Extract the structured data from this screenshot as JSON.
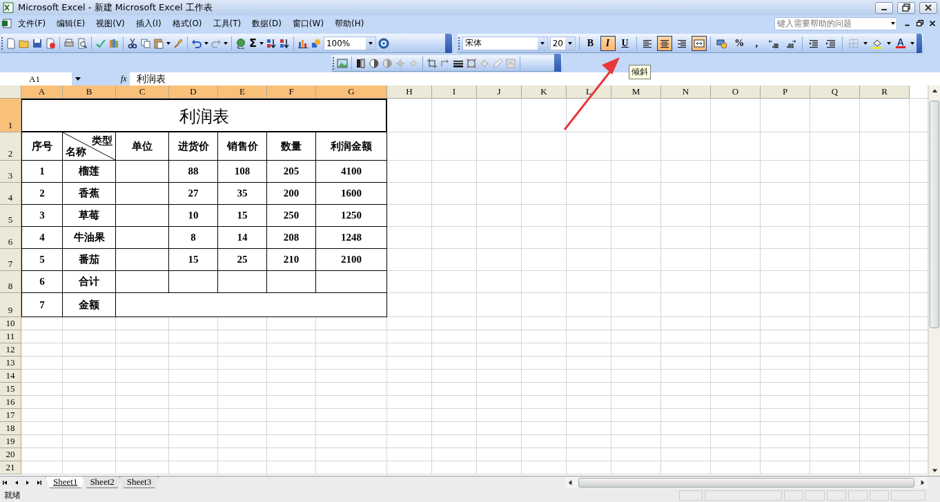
{
  "window": {
    "title": "Microsoft Excel - 新建 Microsoft Excel 工作表"
  },
  "menu": {
    "items": [
      "文件(F)",
      "编辑(E)",
      "视图(V)",
      "插入(I)",
      "格式(O)",
      "工具(T)",
      "数据(D)",
      "窗口(W)",
      "帮助(H)"
    ],
    "help_search": {
      "placeholder": "键入需要帮助的问题"
    }
  },
  "standard_toolbar": {
    "sum_symbol": "Σ",
    "zoom": "100%"
  },
  "formatting_toolbar": {
    "font": "宋体",
    "size": "20",
    "buttons": [
      {
        "kind": "bold",
        "label": "B",
        "pressed": false
      },
      {
        "kind": "italic",
        "label": "I",
        "pressed": true
      },
      {
        "kind": "underline",
        "label": "U",
        "pressed": false
      },
      {
        "kind": "align_left",
        "pressed": false
      },
      {
        "kind": "align_center",
        "pressed": true
      },
      {
        "kind": "align_right",
        "pressed": false
      },
      {
        "kind": "merge_center",
        "pressed": true
      },
      {
        "kind": "currency",
        "pressed": false
      },
      {
        "kind": "percent",
        "label": "%",
        "pressed": false
      },
      {
        "kind": "comma",
        "label": ",",
        "pressed": false
      },
      {
        "kind": "increase_decimal",
        "pressed": false
      },
      {
        "kind": "decrease_decimal",
        "pressed": false
      },
      {
        "kind": "decrease_indent",
        "pressed": false
      },
      {
        "kind": "increase_indent",
        "pressed": false
      },
      {
        "kind": "borders",
        "pressed": false
      },
      {
        "kind": "fill_color",
        "pressed": false
      },
      {
        "kind": "font_color",
        "label": "A",
        "pressed": false
      }
    ]
  },
  "tooltip": "倾斜",
  "formula_bar": {
    "name_box": "A1",
    "function_label": "fx",
    "formula": "利润表"
  },
  "sheet": {
    "columns": [
      {
        "label": "A",
        "selected": true
      },
      {
        "label": "B",
        "selected": true
      },
      {
        "label": "C",
        "selected": true
      },
      {
        "label": "D",
        "selected": true
      },
      {
        "label": "E",
        "selected": true
      },
      {
        "label": "F",
        "selected": true
      },
      {
        "label": "G",
        "selected": true
      },
      {
        "label": "H",
        "selected": false
      },
      {
        "label": "I",
        "selected": false
      },
      {
        "label": "J",
        "selected": false
      },
      {
        "label": "K",
        "selected": false
      },
      {
        "label": "L",
        "selected": false
      },
      {
        "label": "M",
        "selected": false
      },
      {
        "label": "N",
        "selected": false
      },
      {
        "label": "O",
        "selected": false
      },
      {
        "label": "P",
        "selected": false
      },
      {
        "label": "Q",
        "selected": false
      },
      {
        "label": "R",
        "selected": false
      }
    ],
    "row_headers": [
      {
        "label": "1",
        "selected": true
      },
      {
        "label": "2",
        "selected": false
      },
      {
        "label": "3",
        "selected": false
      },
      {
        "label": "4",
        "selected": false
      },
      {
        "label": "5",
        "selected": false
      },
      {
        "label": "6",
        "selected": false
      },
      {
        "label": "7",
        "selected": false
      },
      {
        "label": "8",
        "selected": false
      },
      {
        "label": "9",
        "selected": false
      },
      {
        "label": "10",
        "selected": false
      },
      {
        "label": "11",
        "selected": false
      },
      {
        "label": "12",
        "selected": false
      },
      {
        "label": "13",
        "selected": false
      },
      {
        "label": "14",
        "selected": false
      },
      {
        "label": "15",
        "selected": false
      },
      {
        "label": "16",
        "selected": false
      },
      {
        "label": "17",
        "selected": false
      },
      {
        "label": "18",
        "selected": false
      },
      {
        "label": "19",
        "selected": false
      },
      {
        "label": "20",
        "selected": false
      },
      {
        "label": "21",
        "selected": false
      }
    ],
    "title": "利润表",
    "header": {
      "number": "序号",
      "type_label": "类型",
      "name_label": "名称",
      "unit": "单位",
      "purchase_price": "进货价",
      "sale_price": "销售价",
      "quantity": "数量",
      "profit": "利润金额"
    },
    "rows": [
      {
        "kind": "item",
        "number": "1",
        "name": "榴莲",
        "purchase_price": "88",
        "sale_price": "108",
        "quantity": "205",
        "profit": "4100"
      },
      {
        "kind": "item",
        "number": "2",
        "name": "香蕉",
        "purchase_price": "27",
        "sale_price": "35",
        "quantity": "200",
        "profit": "1600"
      },
      {
        "kind": "item",
        "number": "3",
        "name": "草莓",
        "purchase_price": "10",
        "sale_price": "15",
        "quantity": "250",
        "profit": "1250"
      },
      {
        "kind": "item",
        "number": "4",
        "name": "牛油果",
        "purchase_price": "8",
        "sale_price": "14",
        "quantity": "208",
        "profit": "1248"
      },
      {
        "kind": "item",
        "number": "5",
        "name": "番茄",
        "purchase_price": "15",
        "sale_price": "25",
        "quantity": "210",
        "profit": "2100"
      },
      {
        "kind": "sum",
        "number": "6",
        "name": "合计"
      },
      {
        "kind": "amount",
        "number": "7",
        "name": "金额"
      }
    ]
  },
  "sheet_tabs": [
    {
      "label": "Sheet1",
      "selected": true
    },
    {
      "label": "Sheet2",
      "selected": false
    },
    {
      "label": "Sheet3",
      "selected": false
    }
  ],
  "status_bar": {
    "text": "就绪"
  }
}
